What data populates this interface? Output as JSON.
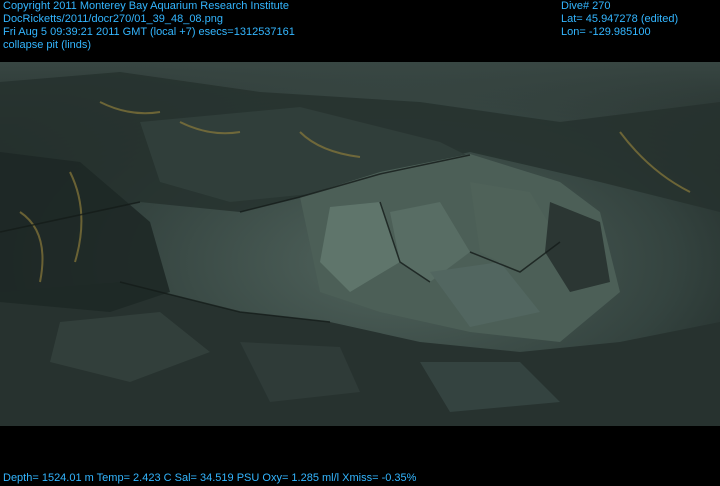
{
  "header": {
    "left_lines": [
      "Copyright 2011 Monterey Bay Aquarium Research Institute",
      "DocRicketts/2011/docr270/01_39_48_08.png",
      "Fri Aug  5 09:39:21 2011 GMT (local +7)  esecs=1312537161",
      "collapse pit (linds)"
    ],
    "right_lines": [
      "Dive# 270",
      "Lat= 45.947278 (edited)",
      "Lon= -129.985100"
    ]
  },
  "footer": {
    "telemetry": "Depth= 1524.01 m  Temp= 2.423 C  Sal= 34.519 PSU  Oxy= 1.285 ml/l  Xmiss= -0.35%"
  },
  "colors": {
    "overlay_text": "#33b6ff",
    "background": "#000000",
    "water": "#2d3b38",
    "rock_dark": "#1c2522",
    "rock_light": "#5a6f66",
    "sediment": "#8a7a3a"
  }
}
